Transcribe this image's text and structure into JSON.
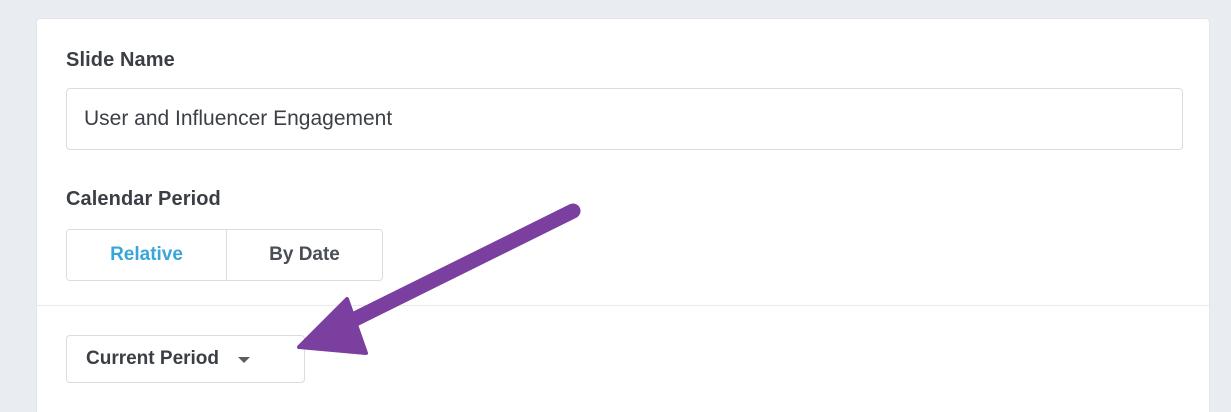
{
  "slide_name": {
    "label": "Slide Name",
    "value": "User and Influencer Engagement"
  },
  "calendar_period": {
    "label": "Calendar Period",
    "options": [
      "Relative",
      "By Date"
    ],
    "selected": "Relative"
  },
  "period_dropdown": {
    "label": "Current Period",
    "icon": "caret-down-icon"
  },
  "annotation": {
    "arrow_color": "#7b3fa0",
    "accent_color": "#3aa6d8"
  }
}
